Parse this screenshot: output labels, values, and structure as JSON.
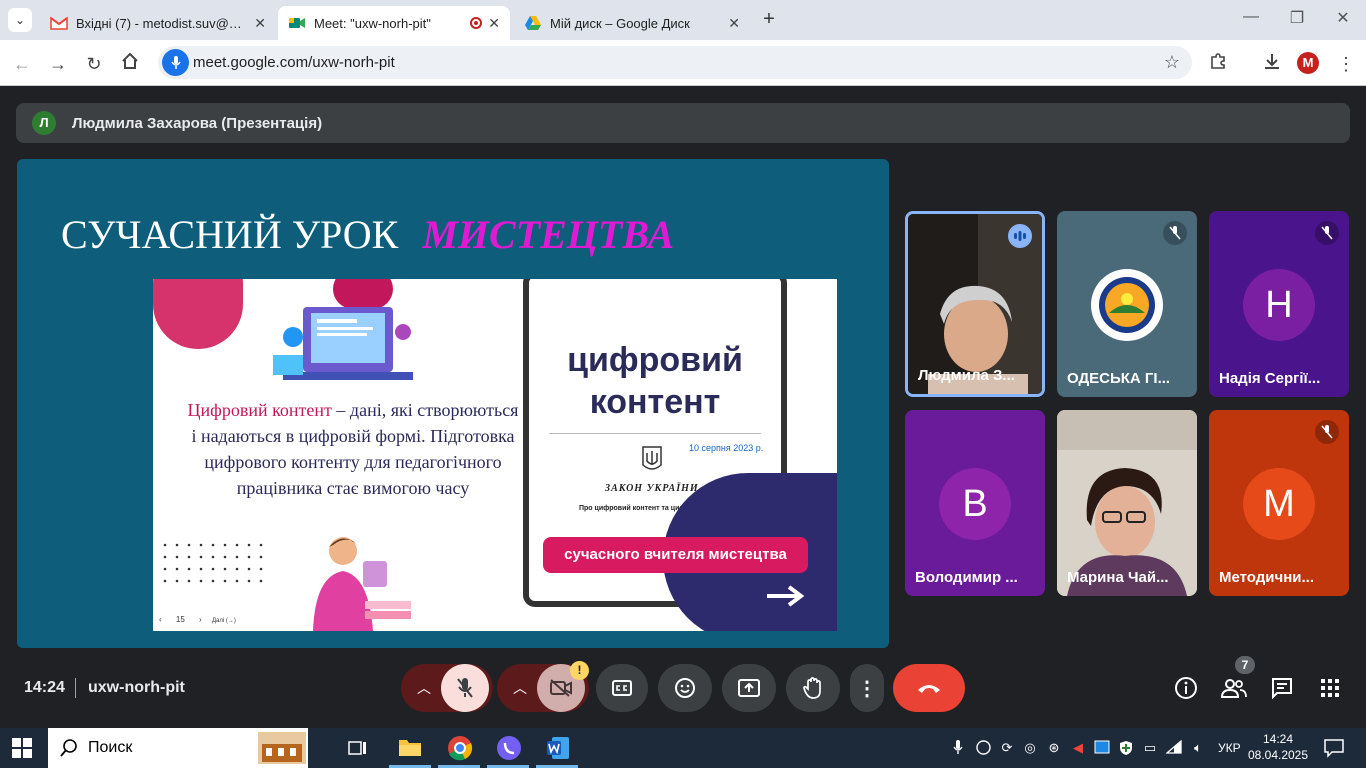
{
  "browser": {
    "tabs": [
      {
        "title": "Вхідні (7) - metodist.suv@gmail.com",
        "icon": "gmail-icon"
      },
      {
        "title": "Meet: \"uxw-norh-pit\"",
        "icon": "meet-icon"
      },
      {
        "title": "Мій диск – Google Диск",
        "icon": "drive-icon"
      }
    ],
    "url": "meet.google.com/uxw-norh-pit",
    "profile_initial": "M"
  },
  "meet": {
    "presenter_initial": "Л",
    "presenter_label": "Людмила Захарова (Презентація)",
    "slide": {
      "title_part1": "СУЧАСНИЙ УРОК",
      "title_part2": "МИСТЕЦТВА",
      "text_highlight": "Цифровий контент",
      "text_body": " – дані, які створюються і надаються в цифровій формі.  Підготовка цифрового контенту для педагогічного працівника стає вимогою часу",
      "doc_title_line1": "цифровий",
      "doc_title_line2": "контент",
      "doc_date": "10 серпня 2023 р.",
      "doc_law": "ЗАКОН УКРАЇНИ",
      "doc_law_sub": "Про цифровий контент та цифрові послуги",
      "doc_banner": "сучасного вчителя мистецтва",
      "page_number": "15",
      "nav_next": "Далі (→)"
    },
    "participants": [
      {
        "name": "Людмила З...",
        "type": "video"
      },
      {
        "name": "ОДЕСЬКА ГІ...",
        "type": "logo",
        "muted": true
      },
      {
        "name": "Надія Сергії...",
        "initial": "Н",
        "bg": "#4a148c",
        "avatar": "#7b1fa2",
        "muted": true
      },
      {
        "name": "Володимир ...",
        "initial": "В",
        "bg": "#6a1b9a",
        "avatar": "#8e24aa",
        "muted": false
      },
      {
        "name": "Марина Чай...",
        "type": "video2"
      },
      {
        "name": "Методични...",
        "initial": "М",
        "bg": "#bf360c",
        "avatar": "#e64a19",
        "muted": true
      }
    ],
    "bottom": {
      "time": "14:24",
      "meeting_code": "uxw-norh-pit",
      "people_count": "7",
      "camera_warning": "!"
    }
  },
  "taskbar": {
    "search_placeholder": "Поиск",
    "lang": "УКР",
    "clock_time": "14:24",
    "clock_date": "08.04.2025"
  },
  "colors": {
    "slide_bg": "#0e5d7a",
    "accent_magenta": "#d81b9a",
    "end_call": "#ea4335",
    "mic_off_bg": "#f9dedc"
  }
}
